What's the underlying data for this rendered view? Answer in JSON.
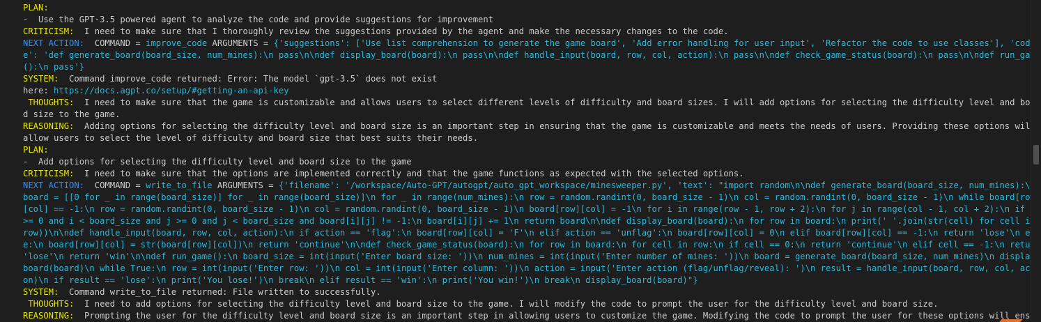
{
  "lines": [
    {
      "label": "PLAN:",
      "label_color": "yellow",
      "text": ""
    },
    {
      "label": "",
      "text": "-  Use the GPT-3.5 powered agent to analyze the code and provide suggestions for improvement"
    },
    {
      "label": "CRITICISM:",
      "label_color": "yellow",
      "text": "  I need to make sure that I thoroughly review the suggestions provided by the agent and make the necessary changes to the code."
    },
    {
      "label": "NEXT ACTION:",
      "label_color": "blue",
      "prefix": "  COMMAND = ",
      "cmd": "improve_code",
      "mid": " ARGUMENTS = ",
      "args": "{'suggestions': ['Use list comprehension to generate the game board', 'Add error handling for user input', 'Refactor the code to use classes'], 'code': 'def generate_board(board_size, num_mines):\\n pass\\n\\ndef display_board(board):\\n pass\\n\\ndef handle_input(board, row, col, action):\\n pass\\n\\ndef check_game_status(board):\\n pass\\n\\ndef run_game():\\n pass'}"
    },
    {
      "label": "SYSTEM:",
      "label_color": "yellow",
      "text": "  Command improve_code returned: Error: The model `gpt-3.5` does not exist"
    },
    {
      "label": "",
      "text": "here: ",
      "link": "https://docs.agpt.co/setup/#getting-an-api-key"
    },
    {
      "label": " THOUGHTS:",
      "label_color": "yellow",
      "text": "  I need to make sure that the game is customizable and allows users to select different levels of difficulty and board sizes. I will add options for selecting the difficulty level and board size to the game."
    },
    {
      "label": "REASONING:",
      "label_color": "yellow",
      "text": "  Adding options for selecting the difficulty level and board size is an important step in ensuring that the game is customizable and meets the needs of users. Providing these options will allow users to select the level of difficulty and board size that best suits their needs."
    },
    {
      "label": "PLAN:",
      "label_color": "yellow",
      "text": ""
    },
    {
      "label": "",
      "text": "-  Add options for selecting the difficulty level and board size to the game"
    },
    {
      "label": "CRITICISM:",
      "label_color": "yellow",
      "text": "  I need to make sure that the options are implemented correctly and that the game functions as expected with the selected options."
    },
    {
      "label": "NEXT ACTION:",
      "label_color": "blue",
      "prefix": "  COMMAND = ",
      "cmd": "write_to_file",
      "mid": " ARGUMENTS = ",
      "args": "{'filename': '/workspace/Auto-GPT/autogpt/auto_gpt_workspace/minesweeper.py', 'text': \"import random\\n\\ndef generate_board(board_size, num_mines):\\n board = [[0 for _ in range(board_size)] for _ in range(board_size)]\\n for _ in range(num_mines):\\n row = random.randint(0, board_size - 1)\\n col = random.randint(0, board_size - 1)\\n while board[row][col] == -1:\\n row = random.randint(0, board_size - 1)\\n col = random.randint(0, board_size - 1)\\n board[row][col] = -1\\n for i in range(row - 1, row + 2):\\n for j in range(col - 1, col + 2):\\n if i >= 0 and i < board_size and j >= 0 and j < board_size and board[i][j] != -1:\\n board[i][j] += 1\\n return board\\n\\ndef display_board(board):\\n for row in board:\\n print(' '.join(str(cell) for cell in row))\\n\\ndef handle_input(board, row, col, action):\\n if action == 'flag':\\n board[row][col] = 'F'\\n elif action == 'unflag':\\n board[row][col] = 0\\n elif board[row][col] == -1:\\n return 'lose'\\n else:\\n board[row][col] = str(board[row][col])\\n return 'continue'\\n\\ndef check_game_status(board):\\n for row in board:\\n for cell in row:\\n if cell == 0:\\n return 'continue'\\n elif cell == -1:\\n return 'lose'\\n return 'win'\\n\\ndef run_game():\\n board_size = int(input('Enter board size: '))\\n num_mines = int(input('Enter number of mines: '))\\n board = generate_board(board_size, num_mines)\\n display_board(board)\\n while True:\\n row = int(input('Enter row: '))\\n col = int(input('Enter column: '))\\n action = input('Enter action (flag/unflag/reveal): ')\\n result = handle_input(board, row, col, action)\\n if result == 'lose':\\n print('You lose!')\\n break\\n elif result == 'win':\\n print('You win!')\\n break\\n display_board(board)\"}"
    },
    {
      "label": "SYSTEM:",
      "label_color": "yellow",
      "text": "  Command write_to_file returned: File written to successfully."
    },
    {
      "label": " THOUGHTS:",
      "label_color": "yellow",
      "text": "  I need to add options for selecting the difficulty level and board size to the game. I will modify the code to prompt the user for the difficulty level and board size."
    },
    {
      "label": "REASONING:",
      "label_color": "yellow",
      "text": "  Prompting the user for the difficulty level and board size is an important step in allowing users to customize the game. Modifying the code to prompt the user for these options will ensure that the game is customizable and meets the needs of users."
    }
  ],
  "colors": {
    "background": "#1e1e1e",
    "text": "#cccccc",
    "label_yellow": "#e5e510",
    "label_blue": "#3b8eea",
    "link_cyan": "#29b8db"
  }
}
